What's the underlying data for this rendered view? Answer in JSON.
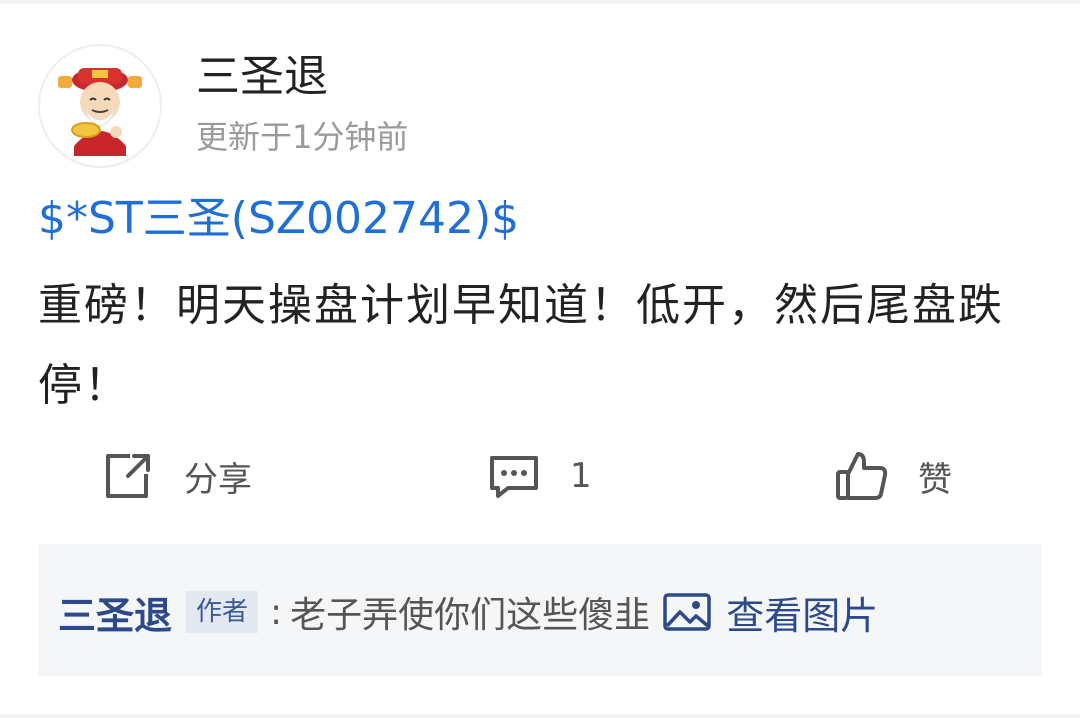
{
  "post": {
    "author": "三圣退",
    "updated": "更新于1分钟前",
    "stock_tag": "$*ST三圣(SZ002742)$",
    "body": "重磅！明天操盘计划早知道！低开，然后尾盘跌停！"
  },
  "actions": {
    "share_label": "分享",
    "comment_count": "1",
    "like_label": "赞"
  },
  "comment_preview": {
    "author": "三圣退",
    "badge": "作者",
    "separator": ":",
    "text": "老子弄使你们这些傻韭",
    "view_image_label": "查看图片"
  },
  "colors": {
    "link_blue": "#1f6fd6",
    "comment_author": "#2c4a8a",
    "comment_bg": "#f5f6f8"
  },
  "icons": {
    "share": "share-icon",
    "comment": "comment-icon",
    "like": "thumbs-up-icon",
    "image": "image-icon"
  }
}
